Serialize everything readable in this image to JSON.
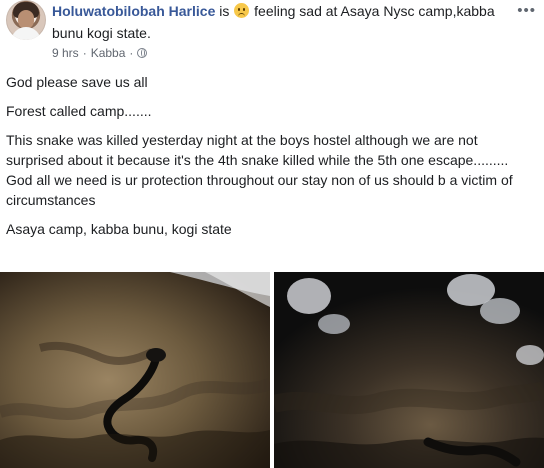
{
  "post": {
    "author": "Holuwatobilobah Harlice",
    "status_prefix": " is ",
    "feeling": "feeling sad at Asaya Nysc camp,kabba bunu kogi state.",
    "time": "9 hrs",
    "dot": "·",
    "location": "Kabba",
    "lines": [
      "God please save us all",
      "Forest called camp.......",
      "This snake was killed yesterday night at the boys hostel although we are not surprised about it because it's the 4th snake killed while the 5th one escape.........",
      "God all we need is ur protection throughout our stay non of us should b a victim of circumstances",
      "Asaya camp, kabba bunu, kogi state"
    ]
  },
  "icons": {
    "avatar": "profile-photo",
    "feeling": "sad-face-icon",
    "privacy": "globe-icon",
    "menu": "more-icon"
  }
}
